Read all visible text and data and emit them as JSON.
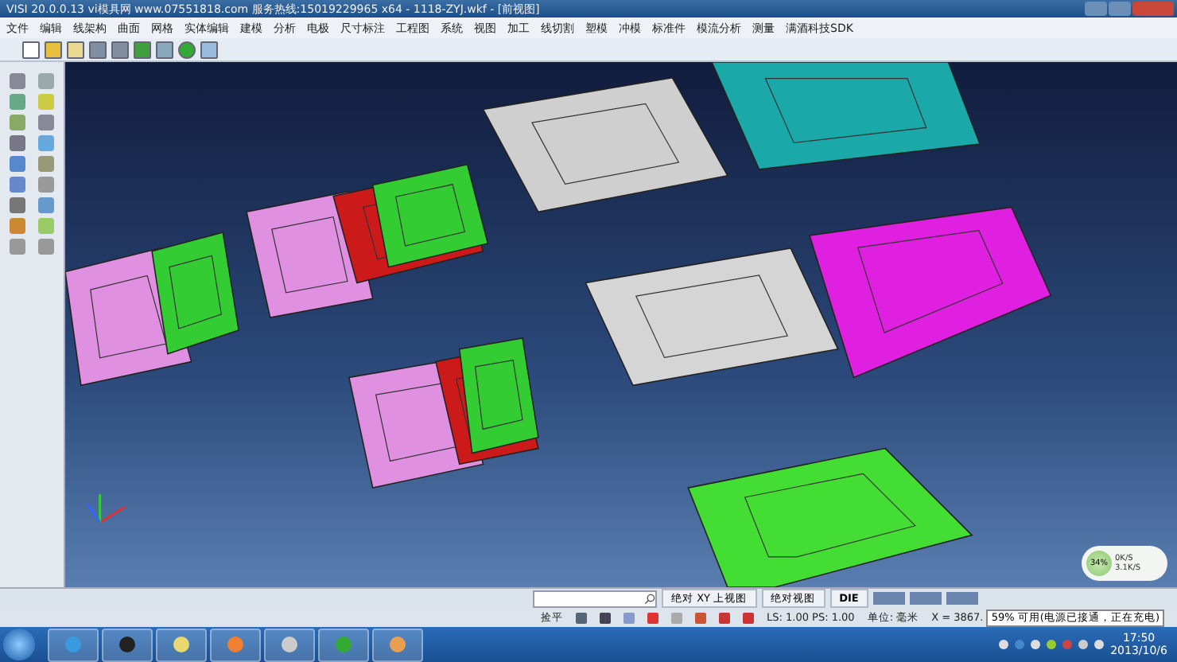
{
  "window": {
    "title": "VISI 20.0.0.13 vi模具网 www.07551818.com 服务热线:15019229965 x64 - 1118-ZYJ.wkf - [前视图]"
  },
  "menu": [
    "文件",
    "编辑",
    "线架构",
    "曲面",
    "网格",
    "实体编辑",
    "建模",
    "分析",
    "电极",
    "尺寸标注",
    "工程图",
    "系统",
    "视图",
    "加工",
    "线切割",
    "塑模",
    "冲模",
    "标准件",
    "模流分析",
    "测量",
    "满酒科技SDK"
  ],
  "network_meter": {
    "percent": "34%",
    "upload": "0K/S",
    "download": "3.1K/S"
  },
  "command_bar": {
    "view_plane": "绝对 XY 上视图",
    "view": "绝对视图",
    "layer": "DIE"
  },
  "status_bar": {
    "mode": "捡平",
    "scale": "LS: 1.00 PS: 1.00",
    "units": "单位: 毫米",
    "coordinate": "X = 3867."
  },
  "battery_tooltip": "59% 可用(电源已接通，正在充电)",
  "taskbar": {
    "time": "17:50",
    "date": "2013/10/6"
  }
}
